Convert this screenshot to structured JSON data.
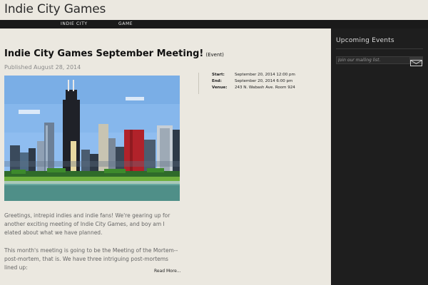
{
  "site": {
    "title": "Indie City Games"
  },
  "nav": {
    "items": [
      {
        "label": "INDIE CITY"
      },
      {
        "label": "GAME"
      }
    ]
  },
  "post": {
    "title": "Indie City Games September Meeting!",
    "tag": "(Event)",
    "published": "Published August 28, 2014",
    "event": {
      "start_label": "Start:",
      "start": "September 20, 2014 12:00 pm",
      "end_label": "End:",
      "end": "September 20, 2014 6:00 pm",
      "venue_label": "Venue:",
      "venue": "243 N. Wabash Ave. Room 924"
    },
    "paragraphs": [
      "Greetings, intrepid indies and indie fans! We're gearing up for another exciting meeting of Indie City Games, and boy am I elated about what we have planned.",
      "This month's meeting is going to be the Meeting of the Mortem--post-mortem, that is. We have three intriguing post-mortems lined up:"
    ],
    "read_more": "Read More..."
  },
  "sidebar": {
    "title": "Upcoming Events",
    "mailing": {
      "placeholder": "Join our mailing list."
    }
  },
  "colors": {
    "page_bg": "#ebe8e0",
    "nav_bg": "#1a1a1a",
    "sidebar_bg": "#1e1e1e",
    "sky": "#7fb0e6",
    "water": "#4f8f88",
    "grass": "#6fb03c"
  },
  "icons": {
    "mail": "envelope-icon"
  }
}
